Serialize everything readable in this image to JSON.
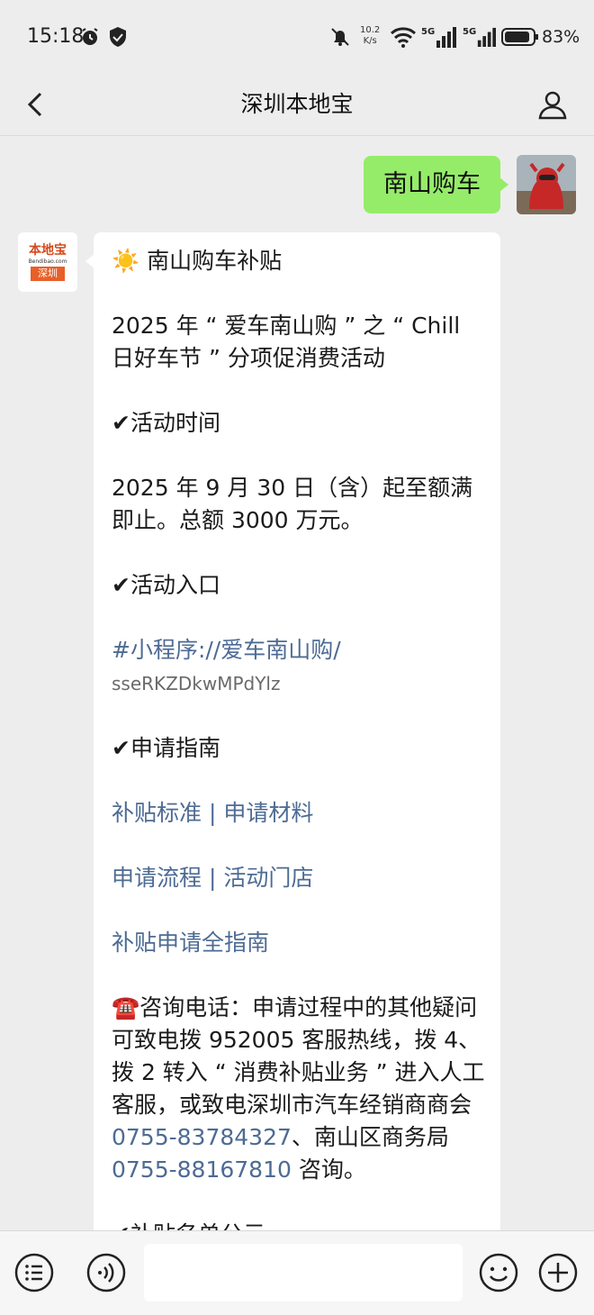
{
  "status_bar": {
    "time": "15:18",
    "net_speed_value": "10.2",
    "net_speed_unit": "K/s",
    "sig1_label": "5G",
    "sig2_label": "5G",
    "battery": "83%"
  },
  "header": {
    "title": "深圳本地宝"
  },
  "sent_message": {
    "text": "南山购车"
  },
  "sender_logo": {
    "top": "本地宝",
    "url": "Bendibao.com",
    "city": "深圳"
  },
  "received_message": {
    "title": "南山购车补贴",
    "intro": "2025 年 “ 爱车南山购 ” 之 “ Chill 日好车节 ” 分项促消费活动",
    "section1_title": "活动时间",
    "section1_text": "2025 年 9 月 30 日（含）起至额满即止。总额 3000 万元。",
    "section2_title": "活动入口",
    "section2_link": "#小程序://爱车南山购/",
    "section2_code": "sseRKZDkwMPdYlz",
    "section3_title": "申请指南",
    "links": [
      "补贴标准 | 申请材料",
      "申请流程 | 活动门店",
      "补贴申请全指南"
    ],
    "contact_text_1": "咨询电话：申请过程中的其他疑问可致电拨 952005 客服热线，拨 4、拨 2 转入 “ 消费补贴业务 ” 进入人工客服，或致电深圳市汽车经销商商会 ",
    "phone_1": "0755-83784327",
    "contact_text_2": "、南山区商务局 ",
    "phone_2": "0755-88167810",
    "contact_text_3": " 咨询。",
    "next_section_partial": "补贴名单公示"
  },
  "icons": {
    "alarm": "alarm-icon",
    "shield": "shield-icon",
    "mute": "bell-off-icon",
    "wifi": "wifi-icon",
    "battery": "battery-icon",
    "back": "back-arrow-icon",
    "profile": "person-icon",
    "menu": "menu-list-icon",
    "voice": "voice-icon",
    "emoji": "emoji-icon",
    "plus": "plus-icon"
  }
}
